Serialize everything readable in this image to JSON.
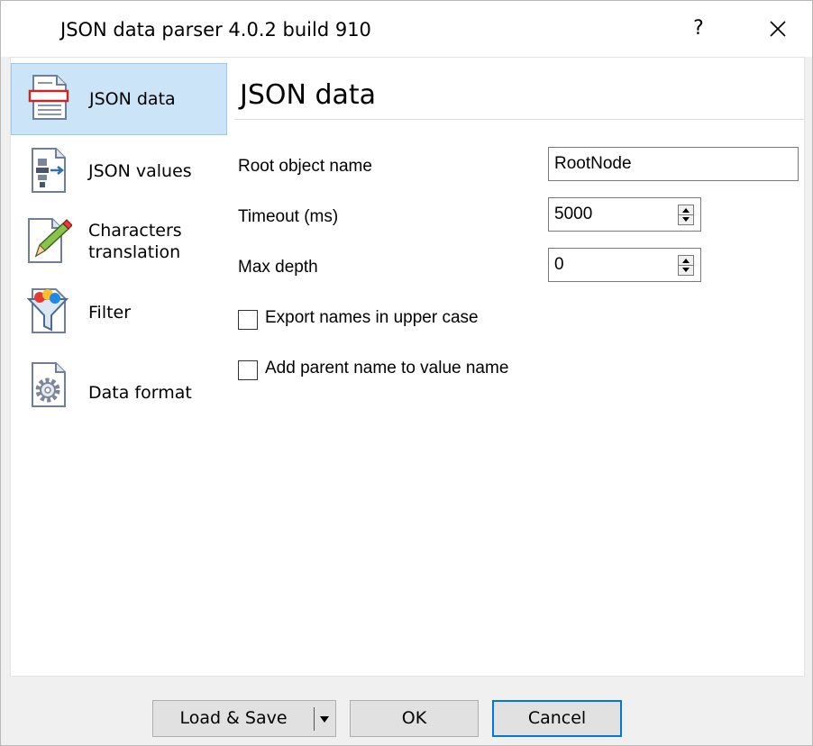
{
  "window": {
    "title": "JSON data parser 4.0.2 build 910",
    "help_label": "?"
  },
  "sidebar": {
    "items": [
      {
        "label": "JSON data",
        "icon": "document-icon",
        "active": true
      },
      {
        "label": "JSON values",
        "icon": "values-icon",
        "active": false
      },
      {
        "label": "Characters\ntranslation",
        "icon": "pencil-icon",
        "active": false
      },
      {
        "label": "Filter",
        "icon": "funnel-icon",
        "active": false
      },
      {
        "label": "Data format",
        "icon": "gear-icon",
        "active": false
      }
    ]
  },
  "main": {
    "title": "JSON data",
    "fields": {
      "root_object_name": {
        "label": "Root object name",
        "value": "RootNode"
      },
      "timeout": {
        "label": "Timeout (ms)",
        "value": "5000"
      },
      "max_depth": {
        "label": "Max depth",
        "value": "0"
      }
    },
    "checkboxes": {
      "export_upper": {
        "label": "Export names in upper case",
        "checked": false
      },
      "add_parent": {
        "label": "Add parent name to value name",
        "checked": false
      }
    }
  },
  "footer": {
    "load_save_label": "Load & Save",
    "ok_label": "OK",
    "cancel_label": "Cancel"
  }
}
